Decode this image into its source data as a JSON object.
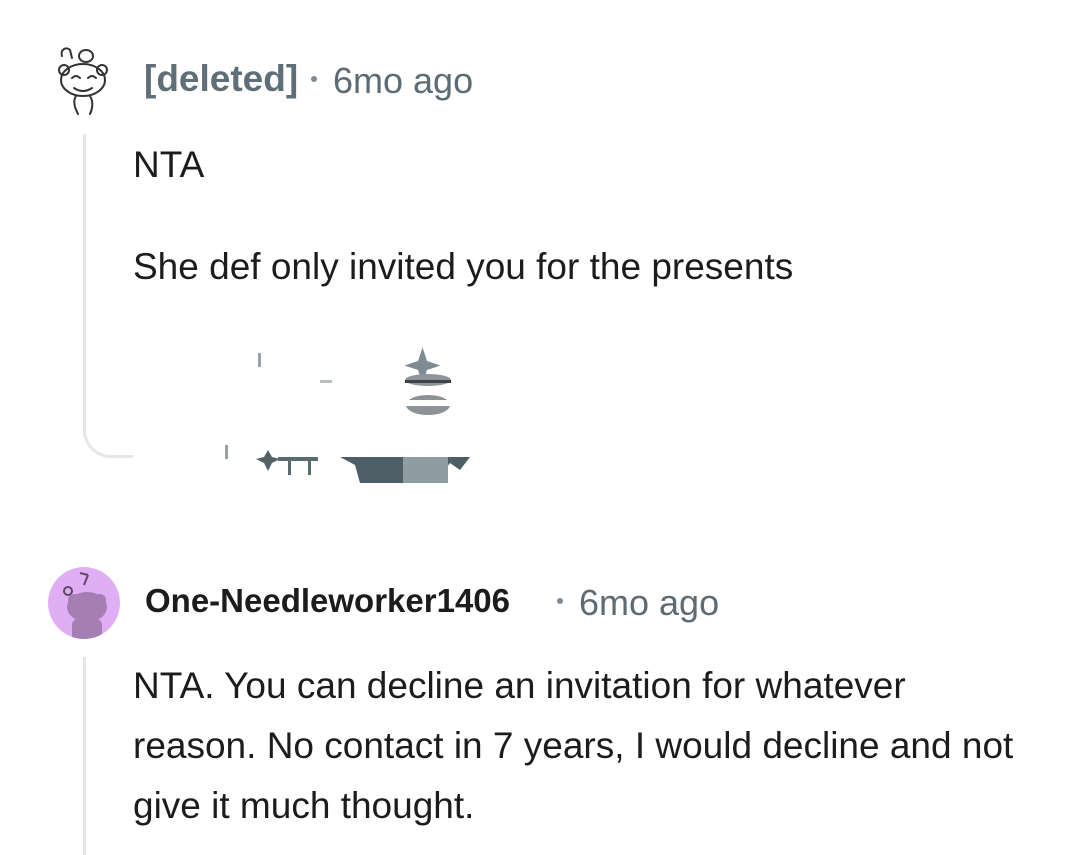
{
  "comments": [
    {
      "author": "[deleted]",
      "age": "6mo ago",
      "paragraphs": [
        "NTA",
        "She def only invited you for the presents"
      ],
      "avatar_icon": "deleted-snoo-avatar-icon",
      "username_color": "#5f6f78"
    },
    {
      "author": "One-Needleworker1406",
      "age": "6mo ago",
      "paragraphs": [
        "NTA. You can decline an invitation for whatever reason. No contact in 7 years, I would decline and not give it much thought."
      ],
      "avatar_icon": "snoo-avatar-icon",
      "avatar_bg": "#e0aef4",
      "username_color": "#1c1c1c"
    }
  ],
  "colors": {
    "thread_line": "#e4e6e8",
    "meta_text": "#5d6b74",
    "body_text": "#1c1c1c"
  }
}
